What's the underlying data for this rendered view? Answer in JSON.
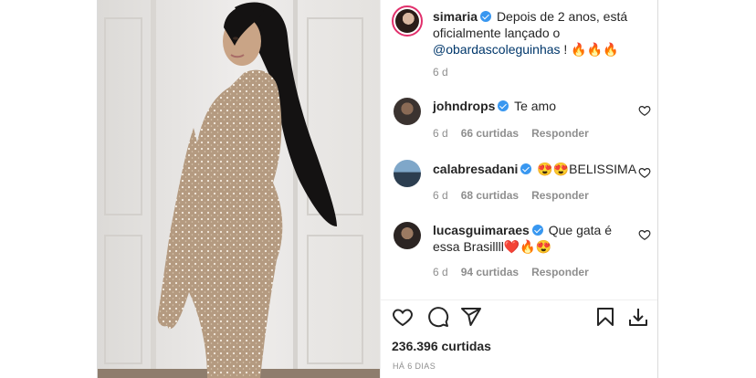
{
  "post": {
    "author": "simaria",
    "caption_line1": "Depois de 2 anos, está",
    "caption_line2": "oficialmente lançado o",
    "caption_mention": "@obardascoleguinhas",
    "caption_tail": " ! 🔥🔥🔥",
    "age": "6 d",
    "likes": "236.396 curtidas",
    "date": "HÁ 6 DIAS"
  },
  "comments": [
    {
      "user": "johndrops",
      "text": "Te amo",
      "text2": "",
      "age": "6 d",
      "likes": "66 curtidas",
      "reply": "Responder"
    },
    {
      "user": "calabresadani",
      "text": "😍😍BELISSIMA",
      "text2": "",
      "age": "6 d",
      "likes": "68 curtidas",
      "reply": "Responder"
    },
    {
      "user": "lucasguimaraes",
      "text": "Que gata é",
      "text2": "essa Brasillll❤️🔥😍",
      "age": "6 d",
      "likes": "94 curtidas",
      "reply": "Responder"
    }
  ],
  "icons": [
    "heart-icon",
    "comment-icon",
    "share-icon",
    "save-icon",
    "download-icon"
  ],
  "colors": {
    "verified": "#3897f0",
    "mention": "#00376b",
    "muted": "#8e8e8e",
    "text": "#262626"
  }
}
